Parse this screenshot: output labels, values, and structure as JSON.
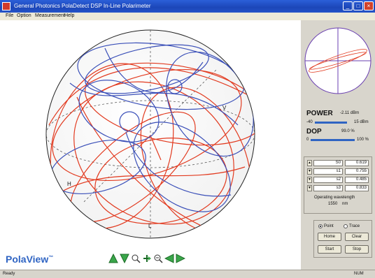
{
  "window": {
    "title": "General Photonics PolaDetect DSP In-Line Polarimeter",
    "min": "_",
    "max": "□",
    "close": "×"
  },
  "menu": [
    "File",
    "Option",
    "Measurement",
    "Help"
  ],
  "plot": {
    "labels": [
      "H",
      "V",
      "L"
    ]
  },
  "logo": {
    "text": "PolaView",
    "mark": "™"
  },
  "toolbar": [
    "arrow-up-icon",
    "arrow-down-icon",
    "zoom-in-icon",
    "move-icon",
    "zoom-out-icon",
    "arrow-left-icon",
    "arrow-right-icon"
  ],
  "panel": {
    "power_label": "POWER",
    "power_value": "-2.11 dBm",
    "power_min": "-40",
    "power_max": "15 dBm",
    "power_level_pct": 83,
    "dop_label": "DOP",
    "dop_value": "99.0 %",
    "dop_min": "0",
    "dop_max": "100 %",
    "dop_level_pct": 99,
    "params": [
      {
        "name": "S0",
        "value": "0.619"
      },
      {
        "name": "s1",
        "value": "0.755"
      },
      {
        "name": "s2",
        "value": "0.485"
      },
      {
        "name": "s3",
        "value": "0.833"
      }
    ],
    "wavelength_label": "Operating wavelength",
    "wavelength_value": "1550",
    "wavelength_unit": "nm",
    "radio_point": "Point",
    "radio_trace": "Trace",
    "btn_home": "Home",
    "btn_clear": "Clear",
    "btn_start": "Start",
    "btn_stop": "Stop"
  },
  "status": {
    "left": "Ready",
    "right": "NUM"
  },
  "colors": {
    "accent": "#2f64c3",
    "trace_red": "#e23a1f",
    "trace_blue": "#3a4fb8"
  }
}
